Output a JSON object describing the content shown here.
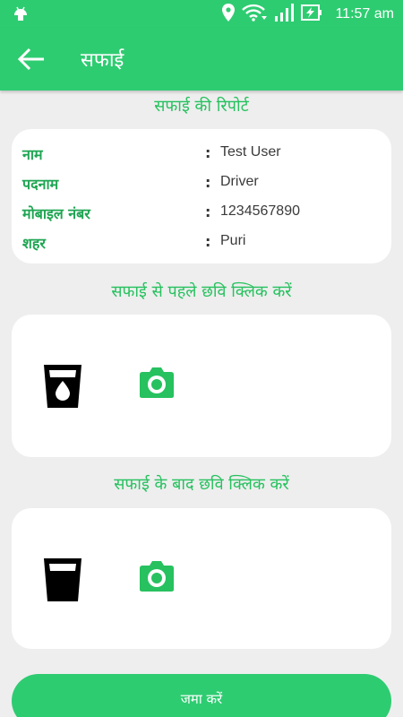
{
  "status_bar": {
    "time": "11:57 am",
    "icons": [
      "android-icon",
      "location-icon",
      "wifi-icon",
      "signal-icon",
      "battery-charging-icon"
    ]
  },
  "app_bar": {
    "title": "सफाई",
    "back_icon": "arrow-left-icon"
  },
  "report": {
    "heading": "सफाई की रिपोर्ट",
    "rows": [
      {
        "label": "नाम",
        "value": "Test User"
      },
      {
        "label": "पदनाम",
        "value": "Driver"
      },
      {
        "label": "मोबाइल नंबर",
        "value": "1234567890"
      },
      {
        "label": "शहर",
        "value": "Puri"
      }
    ],
    "separator": ":"
  },
  "before": {
    "heading": "सफाई से पहले छवि क्लिक करें",
    "icon": "dirty-glass-icon"
  },
  "after": {
    "heading": "सफाई के बाद छवि क्लिक करें",
    "icon": "clean-glass-icon"
  },
  "submit_label": "जमा करें",
  "colors": {
    "accent": "#2ecc71",
    "accent_text": "#27c15f",
    "background": "#eeeeee"
  }
}
